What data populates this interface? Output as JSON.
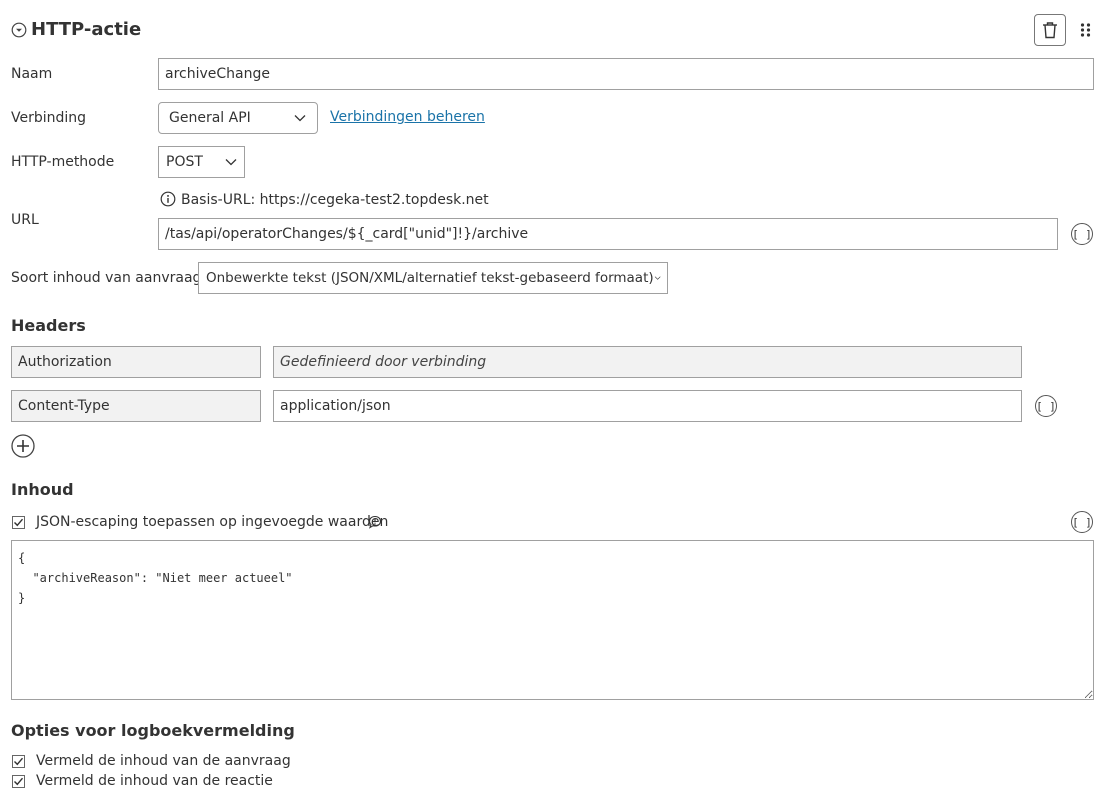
{
  "header": {
    "title": "HTTP-actie"
  },
  "form": {
    "name_label": "Naam",
    "name_value": "archiveChange",
    "connection_label": "Verbinding",
    "connection_value": "General API",
    "manage_connections_link": "Verbindingen beheren",
    "method_label": "HTTP-methode",
    "method_value": "POST",
    "base_url_text": "Basis-URL: https://cegeka-test2.topdesk.net",
    "url_label": "URL",
    "url_value": "/tas/api/operatorChanges/${_card[\"unid\"]!}/archive",
    "content_type_label": "Soort inhoud van aanvraag",
    "content_type_value": "Onbewerkte tekst (JSON/XML/alternatief tekst-gebaseerd formaat)"
  },
  "headers": {
    "title": "Headers",
    "rows": [
      {
        "key": "Authorization",
        "value": "Gedefinieerd door verbinding",
        "value_readonly": true
      },
      {
        "key": "Content-Type",
        "value": "application/json",
        "value_readonly": false
      }
    ]
  },
  "body": {
    "title": "Inhoud",
    "json_escaping_label": "JSON-escaping toepassen op ingevoegde waarden",
    "json_escaping_checked": true,
    "content": "{\n  \"archiveReason\": \"Niet meer actueel\"\n}"
  },
  "logging": {
    "title": "Opties voor logboekvermelding",
    "options": [
      {
        "label": "Vermeld de inhoud van de aanvraag",
        "checked": true
      },
      {
        "label": "Vermeld de inhoud van de reactie",
        "checked": true
      }
    ]
  },
  "icons": {
    "bracket_glyph": "[ ]"
  }
}
